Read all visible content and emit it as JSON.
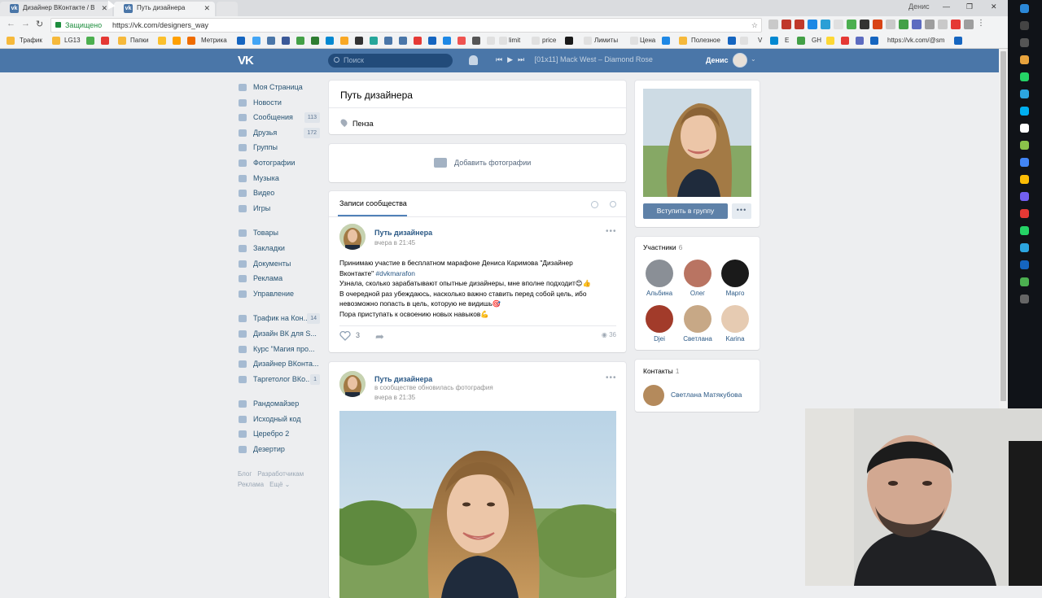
{
  "browser": {
    "tabs": [
      {
        "label": "Дизайнер ВКонтакте / В",
        "active": false
      },
      {
        "label": "Путь дизайнера",
        "active": true
      }
    ],
    "window_user": "Денис",
    "secure_label": "Защищено",
    "url": "https://vk.com/designers_way",
    "bookmarks": [
      "Трафик",
      "LG13",
      "Папки",
      "Метрика",
      "limit",
      "price",
      "Лимиты",
      "Цена",
      "Полезное",
      "V",
      "E",
      "GH",
      "https://vk.com/@sm"
    ]
  },
  "vk_header": {
    "logo": "VK",
    "search_placeholder": "Поиск",
    "track": "[01x11] Mack West – Diamond Rose",
    "user_name": "Денис"
  },
  "sidebar": {
    "items": [
      {
        "label": "Моя Страница",
        "count": ""
      },
      {
        "label": "Новости",
        "count": ""
      },
      {
        "label": "Сообщения",
        "count": "113"
      },
      {
        "label": "Друзья",
        "count": "172"
      },
      {
        "label": "Группы",
        "count": ""
      },
      {
        "label": "Фотографии",
        "count": ""
      },
      {
        "label": "Музыка",
        "count": ""
      },
      {
        "label": "Видео",
        "count": ""
      },
      {
        "label": "Игры",
        "count": ""
      }
    ],
    "items2": [
      {
        "label": "Товары",
        "count": ""
      },
      {
        "label": "Закладки",
        "count": ""
      },
      {
        "label": "Документы",
        "count": ""
      },
      {
        "label": "Реклама",
        "count": ""
      },
      {
        "label": "Управление",
        "count": ""
      }
    ],
    "items3": [
      {
        "label": "Трафик на Кон...",
        "count": "14"
      },
      {
        "label": "Дизайн ВК для S...",
        "count": ""
      },
      {
        "label": "Курс \"Магия про...",
        "count": ""
      },
      {
        "label": "Дизайнер ВКонта...",
        "count": ""
      },
      {
        "label": "Таргетолог ВКо...",
        "count": "1"
      }
    ],
    "items4": [
      {
        "label": "Рандомайзер",
        "count": ""
      },
      {
        "label": "Исходный код",
        "count": ""
      },
      {
        "label": "Церебро 2",
        "count": ""
      },
      {
        "label": "Дезертир",
        "count": ""
      }
    ],
    "footer": [
      "Блог",
      "Разработчикам",
      "Реклама",
      "Ещё ⌄"
    ]
  },
  "group": {
    "title": "Путь дизайнера",
    "city": "Пенза",
    "add_photos": "Добавить фотографии",
    "join_button": "Вступить в группу",
    "more_button": "•••"
  },
  "wall": {
    "tab": "Записи сообщества",
    "posts": [
      {
        "author": "Путь дизайнера",
        "date": "вчера в 21:45",
        "line1": "Принимаю участие в бесплатном марафоне Дениса Каримова \"Дизайнер",
        "line2": "Вконтакте\"",
        "hashtag": "#dvkmarafon",
        "line3": "Узнала, сколько зарабатывают опытные дизайнеры, мне вполне подходит😊👍",
        "line4": "В очередной раз убеждаюсь, насколько важно ставить перед собой цель, ибо",
        "line5": "невозможно попасть в цель, которую не видишь🎯",
        "line6": "Пора приступать к освоению новых навыков💪",
        "likes": "3",
        "views": "36"
      },
      {
        "author": "Путь дизайнера",
        "subtitle": "в сообществе обновилась фотография",
        "date": "вчера в 21:35"
      }
    ]
  },
  "members": {
    "title": "Участники",
    "count": "6",
    "list": [
      {
        "name": "Альбина",
        "color": "#8a8f96"
      },
      {
        "name": "Олег",
        "color": "#b97462"
      },
      {
        "name": "Марго",
        "color": "#1a1a1a"
      },
      {
        "name": "Djei",
        "color": "#a23b2a"
      },
      {
        "name": "Светлана",
        "color": "#c7a886"
      },
      {
        "name": "Karina",
        "color": "#e6cbb2"
      }
    ]
  },
  "contacts": {
    "title": "Контакты",
    "count": "1",
    "name": "Светлана Матякубова"
  },
  "colors": {
    "vk_blue": "#4a76a8",
    "link": "#2a5885",
    "bg": "#edeef0"
  }
}
